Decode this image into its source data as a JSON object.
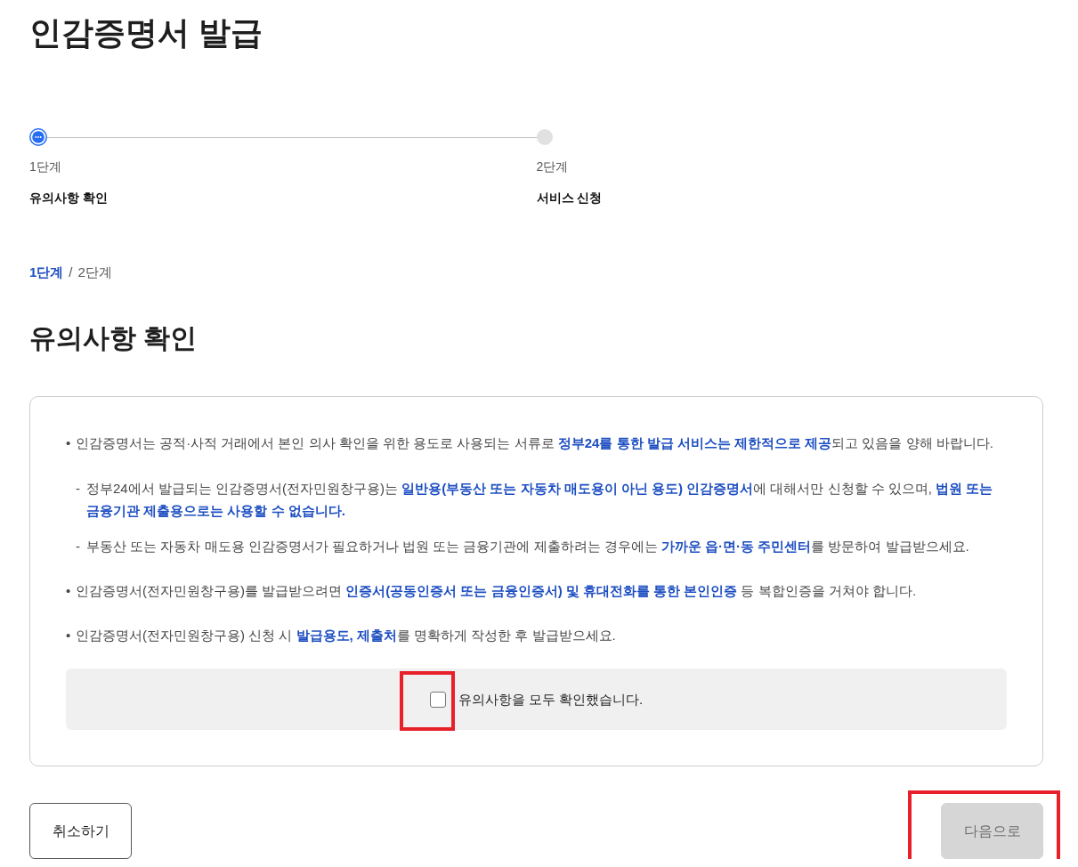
{
  "page_title": "인감증명서 발급",
  "stepper": [
    {
      "number": "1단계",
      "label": "유의사항 확인",
      "selected": true
    },
    {
      "number": "2단계",
      "label": "서비스 신청",
      "selected": false
    }
  ],
  "breadcrumb": {
    "items": [
      {
        "label": "1단계",
        "selected": true
      },
      {
        "label": "2단계",
        "selected": false
      }
    ],
    "separator": "/"
  },
  "section_title": "유의사항 확인",
  "notices": [
    {
      "marker": "•",
      "text": "인감증명서는 공적·사적 거래에서 본인 의사 확인을 위한 용도로 사용되는 서류로 **정부24를 통한 발급 서비스는 제한적으로 제공**되고 있음을 양해 바랍니다.",
      "children": [
        {
          "marker": "-",
          "text": "정부24에서 발급되는 인감증명서(전자민원창구용)는 **일반용(부동산 또는 자동차 매도용이 아닌 용도) 인감증명서**에 대해서만 신청할 수 있으며, **법원 또는 금융기관 제출용으로는 사용할 수 없습니다.**"
        },
        {
          "marker": "-",
          "text": "부동산 또는 자동차 매도용 인감증명서가 필요하거나 법원 또는 금융기관에 제출하려는 경우에는 **가까운 읍·면·동 주민센터**를 방문하여 발급받으세요."
        }
      ]
    },
    {
      "marker": "•",
      "text": "인감증명서(전자민원창구용)를 발급받으려면 **인증서(공동인증서 또는 금융인증서) 및 휴대전화를 통한 본인인증** 등 복합인증을 거쳐야 합니다."
    },
    {
      "marker": "•",
      "text": "인감증명서(전자민원창구용) 신청 시 **발급용도, 제출처**를 명확하게 작성한 후 발급받으세요."
    }
  ],
  "confirm": {
    "label": "유의사항을 모두 확인했습니다.",
    "checked": false,
    "highlighted": true
  },
  "actions": [
    {
      "kind": "outline",
      "label": "취소하기",
      "disabled": false,
      "highlighted": false
    },
    {
      "kind": "solid",
      "label": "다음으로",
      "disabled": true,
      "highlighted": true
    }
  ]
}
